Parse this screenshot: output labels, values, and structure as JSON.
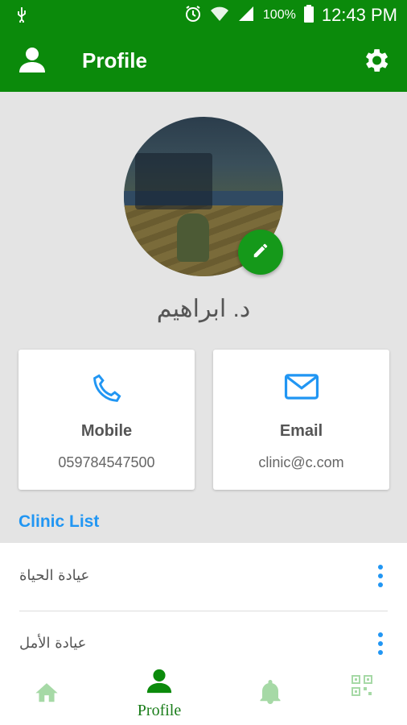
{
  "status_bar": {
    "battery_percent": "100%",
    "time": "12:43 PM",
    "icons": [
      "usb-icon",
      "alarm-icon",
      "wifi-icon",
      "signal-icon",
      "battery-icon"
    ]
  },
  "app_bar": {
    "title": "Profile",
    "left_icon": "person-icon",
    "right_icon": "gear-icon"
  },
  "profile": {
    "name": "د. ابراهيم",
    "edit_icon": "pencil-icon"
  },
  "cards": {
    "mobile": {
      "label": "Mobile",
      "value": "059784547500",
      "icon": "phone-icon"
    },
    "email": {
      "label": "Email",
      "value": "clinic@c.com",
      "icon": "mail-icon"
    }
  },
  "clinic_list": {
    "title": "Clinic List",
    "items": [
      {
        "name": "عيادة الحياة"
      },
      {
        "name": "عيادة الأمل"
      }
    ]
  },
  "bottom_nav": {
    "items": [
      {
        "icon": "home-icon",
        "label": ""
      },
      {
        "icon": "person-icon",
        "label": "Profile",
        "active": true
      },
      {
        "icon": "bell-icon",
        "label": ""
      },
      {
        "icon": "qr-code-icon",
        "label": ""
      }
    ]
  },
  "colors": {
    "primary": "#0b8a0b",
    "accent_blue": "#2196f3",
    "fab_green": "#15991a",
    "nav_inactive": "#a6d9a6"
  }
}
